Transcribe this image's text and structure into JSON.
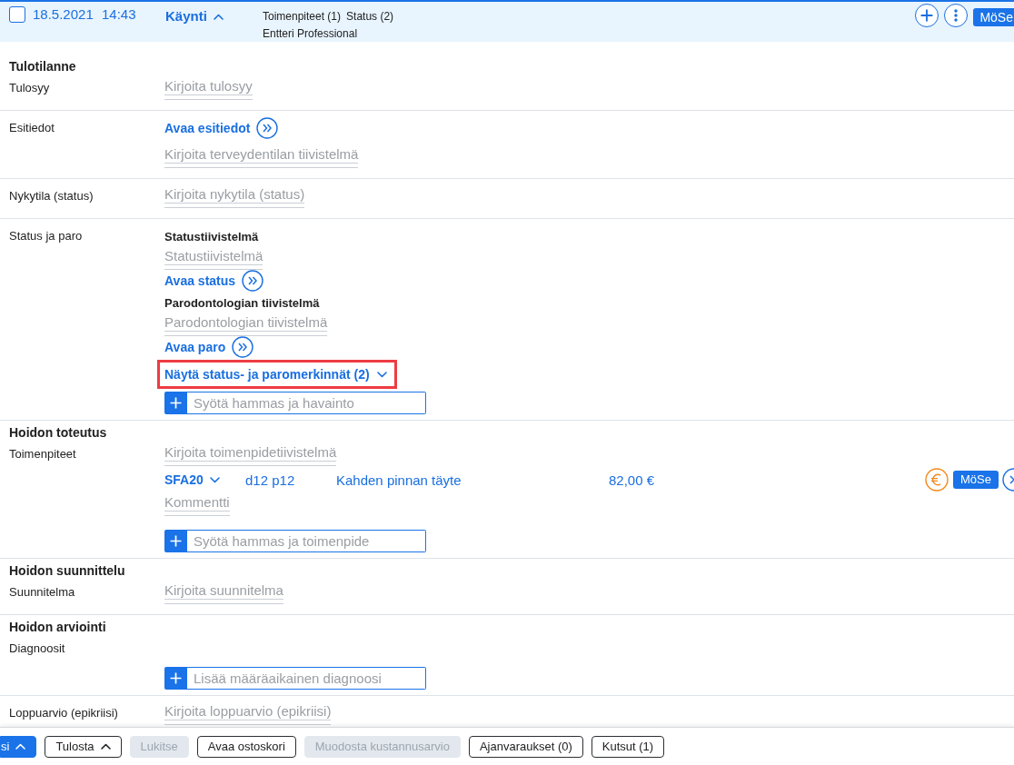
{
  "visit": {
    "checked": false,
    "date": "18.5.2021",
    "time": "14:43",
    "type": "Käynti",
    "expanded": true,
    "counts": [
      "Toimenpiteet (1)",
      "Status (2)"
    ],
    "author": "Entteri Professional",
    "badge": "MöSe"
  },
  "sections": [
    {
      "title": "Tulotilanne",
      "rows": [
        {
          "label": "Tulosyy",
          "items": [
            {
              "kind": "field",
              "placeholder": "Kirjoita tulosyy"
            }
          ]
        }
      ]
    },
    {
      "rows": [
        {
          "label": "Esitiedot",
          "items": [
            {
              "kind": "link",
              "text": "Avaa esitiedot"
            },
            {
              "kind": "field",
              "placeholder": "Kirjoita terveydentilan tiivistelmä"
            }
          ]
        }
      ]
    },
    {
      "rows": [
        {
          "label": "Nykytila (status)",
          "items": [
            {
              "kind": "field",
              "placeholder": "Kirjoita nykytila (status)"
            }
          ]
        }
      ]
    },
    {
      "rows": [
        {
          "label": "Status ja paro",
          "items": [
            {
              "kind": "heading",
              "text": "Statustiivistelmä"
            },
            {
              "kind": "field",
              "placeholder": "Statustiivistelmä"
            },
            {
              "kind": "link",
              "text": "Avaa status"
            },
            {
              "kind": "heading",
              "text": "Parodontologian tiivistelmä"
            },
            {
              "kind": "field",
              "placeholder": "Parodontologian tiivistelmä"
            },
            {
              "kind": "link",
              "text": "Avaa paro"
            },
            {
              "kind": "toggle",
              "text": "Näytä status- ja paromerkinnät (2)",
              "expanded": false,
              "highlighted": true
            },
            {
              "kind": "entry",
              "placeholder": "Syötä hammas ja havainto"
            }
          ]
        }
      ]
    },
    {
      "title": "Hoidon toteutus",
      "rows": [
        {
          "label": "Toimenpiteet",
          "items": [
            {
              "kind": "field",
              "placeholder": "Kirjoita toimenpidetiivistelmä"
            },
            {
              "kind": "procedure",
              "code": "SFA20",
              "expanded": false,
              "teeth": "d12 p12",
              "name": "Kahden pinnan täyte",
              "price": "82,00 €",
              "badge": "MöSe"
            },
            {
              "kind": "field",
              "placeholder": "Kommentti"
            },
            {
              "kind": "entry",
              "placeholder": "Syötä hammas ja toimenpide"
            }
          ]
        }
      ]
    },
    {
      "title": "Hoidon suunnittelu",
      "rows": [
        {
          "label": "Suunnitelma",
          "items": [
            {
              "kind": "field",
              "placeholder": "Kirjoita suunnitelma"
            }
          ]
        }
      ]
    },
    {
      "title": "Hoidon arviointi",
      "rows": [
        {
          "label": "Diagnoosit",
          "items": [
            {
              "kind": "entry",
              "placeholder": "Lisää määräaikainen diagnoosi"
            }
          ]
        },
        {
          "label": "Loppuarvio (epikriisi)",
          "items": [
            {
              "kind": "field",
              "placeholder": "Kirjoita loppuarvio (epikriisi)"
            }
          ]
        }
      ]
    }
  ],
  "action_bar": [
    {
      "label": "si",
      "kind": "primary",
      "disabled": false,
      "has_menu": true
    },
    {
      "label": "Tulosta",
      "kind": "default",
      "disabled": false,
      "has_menu": true
    },
    {
      "label": "Lukitse",
      "kind": "default",
      "disabled": true,
      "has_menu": false
    },
    {
      "label": "Avaa ostoskori",
      "kind": "default",
      "disabled": false,
      "has_menu": false
    },
    {
      "label": "Muodosta kustannusarvio",
      "kind": "default",
      "disabled": true,
      "has_menu": false
    },
    {
      "label": "Ajanvaraukset (0)",
      "kind": "default",
      "disabled": false,
      "has_menu": false
    },
    {
      "label": "Kutsut (1)",
      "kind": "default",
      "disabled": false,
      "has_menu": false
    }
  ]
}
